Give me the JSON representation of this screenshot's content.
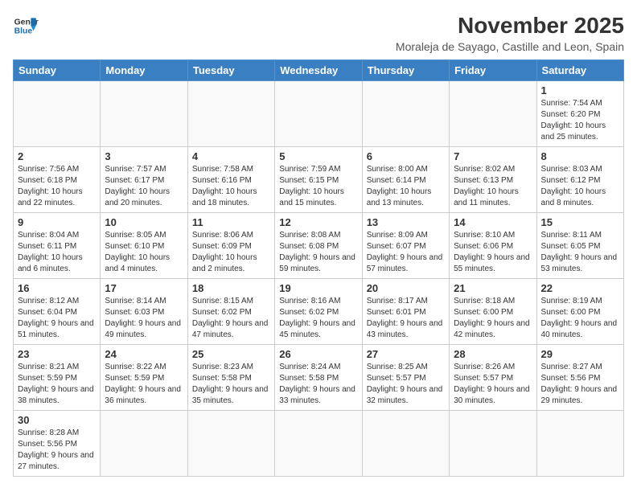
{
  "logo": {
    "line1": "General",
    "line2": "Blue"
  },
  "title": "November 2025",
  "subtitle": "Moraleja de Sayago, Castille and Leon, Spain",
  "weekdays": [
    "Sunday",
    "Monday",
    "Tuesday",
    "Wednesday",
    "Thursday",
    "Friday",
    "Saturday"
  ],
  "weeks": [
    [
      {
        "day": "",
        "info": ""
      },
      {
        "day": "",
        "info": ""
      },
      {
        "day": "",
        "info": ""
      },
      {
        "day": "",
        "info": ""
      },
      {
        "day": "",
        "info": ""
      },
      {
        "day": "",
        "info": ""
      },
      {
        "day": "1",
        "info": "Sunrise: 7:54 AM\nSunset: 6:20 PM\nDaylight: 10 hours and 25 minutes."
      }
    ],
    [
      {
        "day": "2",
        "info": "Sunrise: 7:56 AM\nSunset: 6:18 PM\nDaylight: 10 hours and 22 minutes."
      },
      {
        "day": "3",
        "info": "Sunrise: 7:57 AM\nSunset: 6:17 PM\nDaylight: 10 hours and 20 minutes."
      },
      {
        "day": "4",
        "info": "Sunrise: 7:58 AM\nSunset: 6:16 PM\nDaylight: 10 hours and 18 minutes."
      },
      {
        "day": "5",
        "info": "Sunrise: 7:59 AM\nSunset: 6:15 PM\nDaylight: 10 hours and 15 minutes."
      },
      {
        "day": "6",
        "info": "Sunrise: 8:00 AM\nSunset: 6:14 PM\nDaylight: 10 hours and 13 minutes."
      },
      {
        "day": "7",
        "info": "Sunrise: 8:02 AM\nSunset: 6:13 PM\nDaylight: 10 hours and 11 minutes."
      },
      {
        "day": "8",
        "info": "Sunrise: 8:03 AM\nSunset: 6:12 PM\nDaylight: 10 hours and 8 minutes."
      }
    ],
    [
      {
        "day": "9",
        "info": "Sunrise: 8:04 AM\nSunset: 6:11 PM\nDaylight: 10 hours and 6 minutes."
      },
      {
        "day": "10",
        "info": "Sunrise: 8:05 AM\nSunset: 6:10 PM\nDaylight: 10 hours and 4 minutes."
      },
      {
        "day": "11",
        "info": "Sunrise: 8:06 AM\nSunset: 6:09 PM\nDaylight: 10 hours and 2 minutes."
      },
      {
        "day": "12",
        "info": "Sunrise: 8:08 AM\nSunset: 6:08 PM\nDaylight: 9 hours and 59 minutes."
      },
      {
        "day": "13",
        "info": "Sunrise: 8:09 AM\nSunset: 6:07 PM\nDaylight: 9 hours and 57 minutes."
      },
      {
        "day": "14",
        "info": "Sunrise: 8:10 AM\nSunset: 6:06 PM\nDaylight: 9 hours and 55 minutes."
      },
      {
        "day": "15",
        "info": "Sunrise: 8:11 AM\nSunset: 6:05 PM\nDaylight: 9 hours and 53 minutes."
      }
    ],
    [
      {
        "day": "16",
        "info": "Sunrise: 8:12 AM\nSunset: 6:04 PM\nDaylight: 9 hours and 51 minutes."
      },
      {
        "day": "17",
        "info": "Sunrise: 8:14 AM\nSunset: 6:03 PM\nDaylight: 9 hours and 49 minutes."
      },
      {
        "day": "18",
        "info": "Sunrise: 8:15 AM\nSunset: 6:02 PM\nDaylight: 9 hours and 47 minutes."
      },
      {
        "day": "19",
        "info": "Sunrise: 8:16 AM\nSunset: 6:02 PM\nDaylight: 9 hours and 45 minutes."
      },
      {
        "day": "20",
        "info": "Sunrise: 8:17 AM\nSunset: 6:01 PM\nDaylight: 9 hours and 43 minutes."
      },
      {
        "day": "21",
        "info": "Sunrise: 8:18 AM\nSunset: 6:00 PM\nDaylight: 9 hours and 42 minutes."
      },
      {
        "day": "22",
        "info": "Sunrise: 8:19 AM\nSunset: 6:00 PM\nDaylight: 9 hours and 40 minutes."
      }
    ],
    [
      {
        "day": "23",
        "info": "Sunrise: 8:21 AM\nSunset: 5:59 PM\nDaylight: 9 hours and 38 minutes."
      },
      {
        "day": "24",
        "info": "Sunrise: 8:22 AM\nSunset: 5:59 PM\nDaylight: 9 hours and 36 minutes."
      },
      {
        "day": "25",
        "info": "Sunrise: 8:23 AM\nSunset: 5:58 PM\nDaylight: 9 hours and 35 minutes."
      },
      {
        "day": "26",
        "info": "Sunrise: 8:24 AM\nSunset: 5:58 PM\nDaylight: 9 hours and 33 minutes."
      },
      {
        "day": "27",
        "info": "Sunrise: 8:25 AM\nSunset: 5:57 PM\nDaylight: 9 hours and 32 minutes."
      },
      {
        "day": "28",
        "info": "Sunrise: 8:26 AM\nSunset: 5:57 PM\nDaylight: 9 hours and 30 minutes."
      },
      {
        "day": "29",
        "info": "Sunrise: 8:27 AM\nSunset: 5:56 PM\nDaylight: 9 hours and 29 minutes."
      }
    ],
    [
      {
        "day": "30",
        "info": "Sunrise: 8:28 AM\nSunset: 5:56 PM\nDaylight: 9 hours and 27 minutes."
      },
      {
        "day": "",
        "info": ""
      },
      {
        "day": "",
        "info": ""
      },
      {
        "day": "",
        "info": ""
      },
      {
        "day": "",
        "info": ""
      },
      {
        "day": "",
        "info": ""
      },
      {
        "day": "",
        "info": ""
      }
    ]
  ]
}
